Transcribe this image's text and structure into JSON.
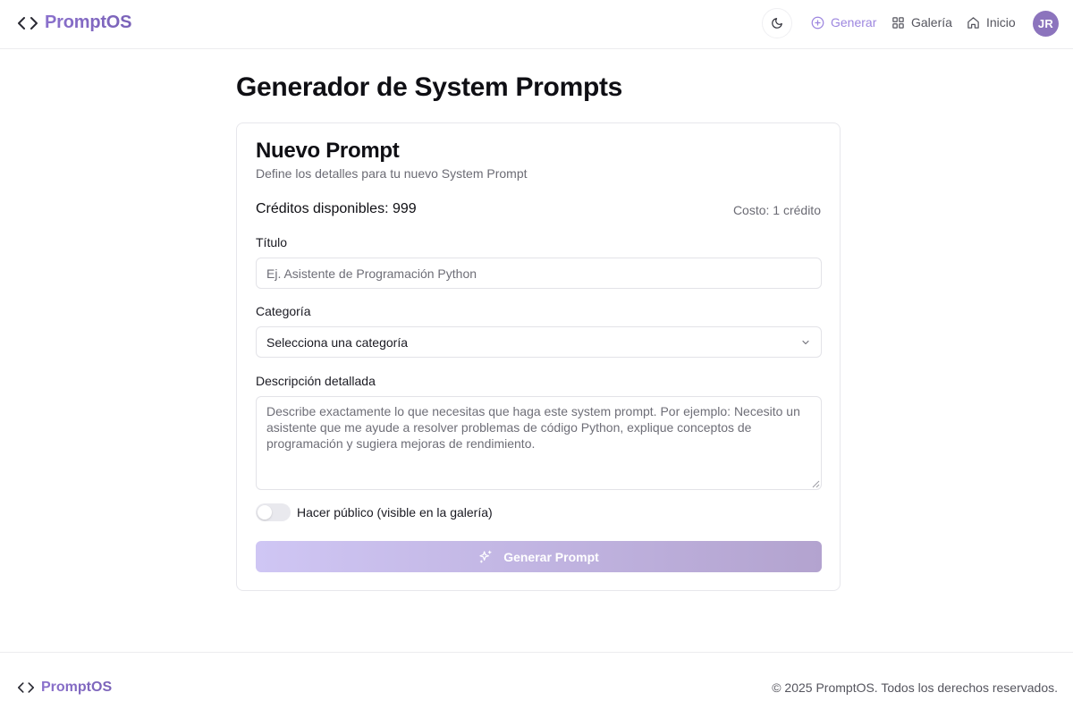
{
  "header": {
    "brand": "PromptOS",
    "nav": [
      {
        "label": "Generar",
        "icon": "plus-circle-icon",
        "active": true
      },
      {
        "label": "Galería",
        "icon": "grid-icon",
        "active": false
      },
      {
        "label": "Inicio",
        "icon": "home-icon",
        "active": false
      }
    ],
    "theme_icon": "moon-icon",
    "avatar_initials": "JR"
  },
  "main": {
    "page_title": "Generador de System Prompts",
    "card": {
      "title": "Nuevo Prompt",
      "subtitle": "Define los detalles para tu nuevo System Prompt",
      "credits": "Créditos disponibles: 999",
      "cost": "Costo: 1 crédito",
      "title_label": "Título",
      "title_placeholder": "Ej. Asistente de Programación Python",
      "category_label": "Categoría",
      "category_value": "Selecciona una categoría",
      "description_label": "Descripción detallada",
      "description_placeholder": "Describe exactamente lo que necesitas que haga este system prompt. Por ejemplo: Necesito un asistente que me ayude a resolver problemas de código Python, explique conceptos de programación y sugiera mejoras de rendimiento.",
      "public_label": "Hacer público (visible en la galería)",
      "public_enabled": false,
      "generate_button": "Generar Prompt"
    }
  },
  "footer": {
    "brand": "PromptOS",
    "copyright": "© 2025 PromptOS. Todos los derechos reservados."
  },
  "colors": {
    "accent": "#9d86df",
    "brand_gradient_start": "#8a70cc",
    "avatar": "#8c74bd",
    "button_gradient_start": "#cfc6f4",
    "button_gradient_end": "#b3a3cf"
  }
}
